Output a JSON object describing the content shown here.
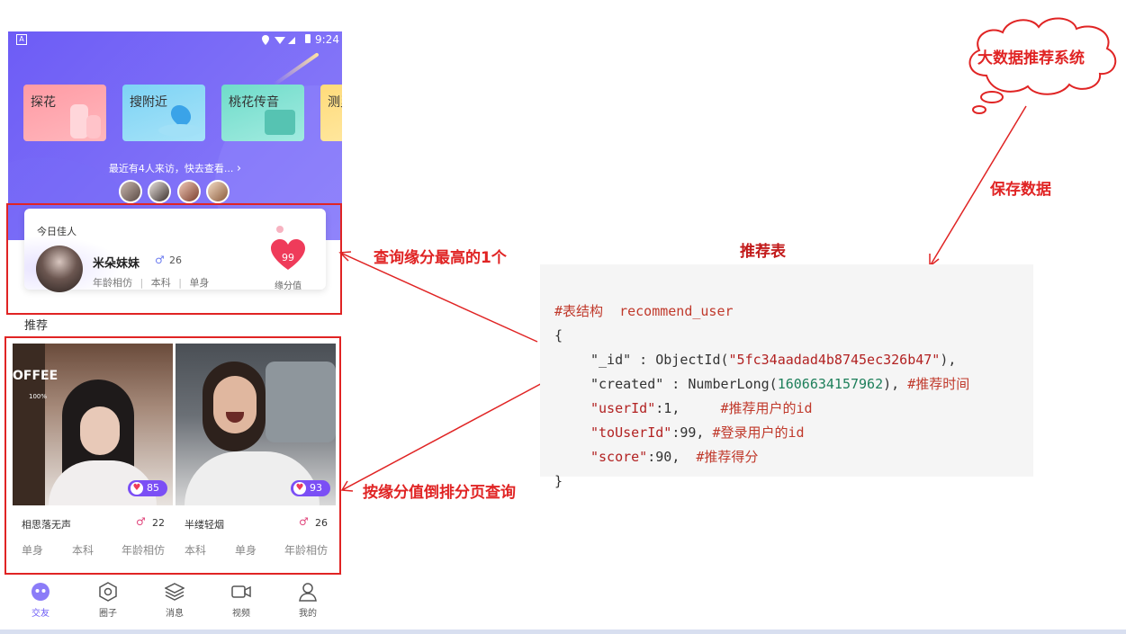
{
  "status_bar": {
    "left_icon": "A",
    "time": "9:24"
  },
  "feature_cards": [
    {
      "label": "探花",
      "color": "#ff9aa2"
    },
    {
      "label": "搜附近",
      "color": "#7fd6f2"
    },
    {
      "label": "桃花传音",
      "color": "#72e0d0"
    },
    {
      "label": "测灵",
      "color": "#ffe08a"
    }
  ],
  "recent_visitors": {
    "text": "最近有4人来访，快去查看...",
    "arrow": "›"
  },
  "today_best": {
    "header": "今日佳人",
    "name": "米朵妹妹",
    "age": "26",
    "tags": [
      "年龄相仿",
      "本科",
      "单身"
    ],
    "score": "99",
    "score_label": "缘分值"
  },
  "recommend_title": "推荐",
  "recommend_cards": [
    {
      "name": "相思落无声",
      "age": "22",
      "score": "85",
      "tags": [
        "单身",
        "本科",
        "年龄相仿"
      ]
    },
    {
      "name": "半缕轻烟",
      "age": "26",
      "score": "93",
      "tags": [
        "本科",
        "单身",
        "年龄相仿"
      ]
    }
  ],
  "photo_text": {
    "coffee": "OFFEE",
    "small": "100%"
  },
  "bottom_nav": [
    {
      "label": "交友",
      "icon": "chat-face-icon",
      "active": true
    },
    {
      "label": "圈子",
      "icon": "hexagon-icon",
      "active": false
    },
    {
      "label": "消息",
      "icon": "layers-icon",
      "active": false
    },
    {
      "label": "视频",
      "icon": "video-camera-icon",
      "active": false
    },
    {
      "label": "我的",
      "icon": "user-icon",
      "active": false
    }
  ],
  "annotations": {
    "cloud": "大数据推荐系统",
    "save": "保存数据",
    "table_title": "推荐表",
    "query_top": "查询缘分最高的1个",
    "query_page": "按缘分值倒排分页查询"
  },
  "code": {
    "comment": "#表结构  recommend_user",
    "open": "{",
    "id_key": "\"_id\"",
    "id_sep": " : ",
    "id_fn": "ObjectId(",
    "id_val": "\"5fc34aadad4b8745ec326b47\"",
    "id_end": "),",
    "created_key": "\"created\"",
    "created_sep": " : ",
    "created_fn": "NumberLong(",
    "created_val": "1606634157962",
    "created_end": "), ",
    "created_comment": "#推荐时间",
    "user_key": "\"userId\"",
    "user_sep": ":",
    "user_val": "1",
    "user_end": ",     ",
    "user_comment": "#推荐用户的id",
    "to_key": "\"toUserId\"",
    "to_sep": ":",
    "to_val": "99",
    "to_end": ", ",
    "to_comment": "#登录用户的id",
    "score_key": "\"score\"",
    "score_sep": ":",
    "score_val": "90",
    "score_end": ",  ",
    "score_comment": "#推荐得分",
    "close": "}"
  },
  "colors": {
    "accent_red": "#e02424",
    "brand_purple": "#6d5cf6",
    "heart": "#ef3b5a"
  }
}
